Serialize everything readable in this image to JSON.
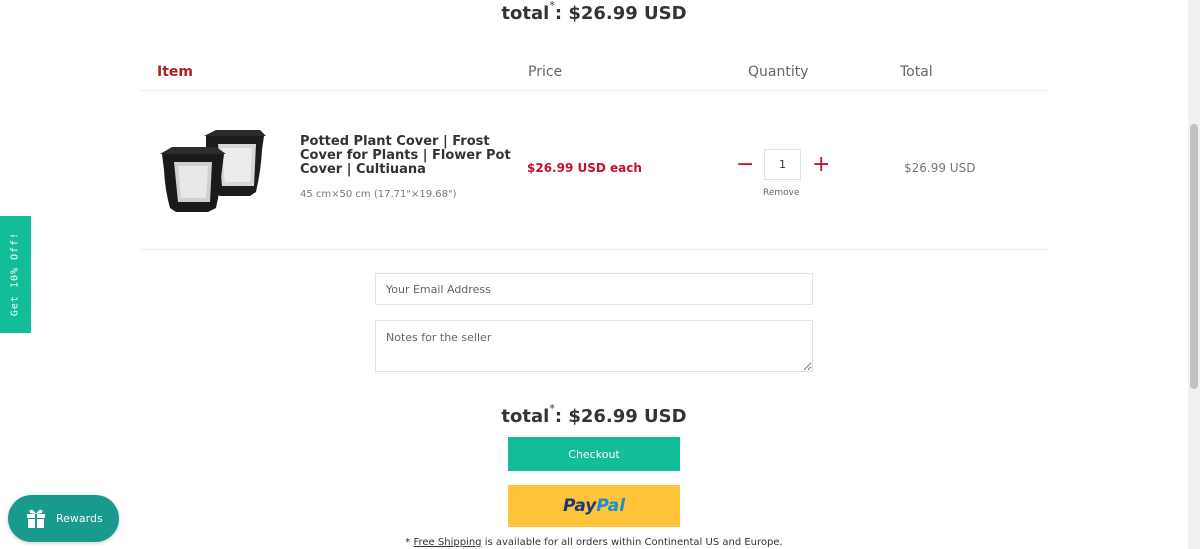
{
  "summary": {
    "total_prefix": "total",
    "total_asterisk": "*",
    "total_colon": ":",
    "total_value": "$26.99 USD"
  },
  "cart": {
    "headers": {
      "item": "Item",
      "price": "Price",
      "quantity": "Quantity",
      "total": "Total"
    },
    "items": [
      {
        "title": "Potted Plant Cover | Frost Cover for Plants | Flower Pot Cover | Cultiuana",
        "variant": "45 cm×50 cm  (17.71\"×19.68\")",
        "price": "$26.99 USD each",
        "quantity": "1",
        "remove_label": "Remove",
        "line_total": "$26.99 USD",
        "minus_symbol": "−",
        "plus_symbol": "+"
      }
    ]
  },
  "form": {
    "email_placeholder": "Your Email Address",
    "notes_placeholder": "Notes for the seller"
  },
  "actions": {
    "checkout_label": "Checkout",
    "paypal_label_a": "Pay",
    "paypal_label_b": "Pal"
  },
  "shipping_note": {
    "prefix": "* ",
    "link": "Free Shipping",
    "suffix": " is available for all orders within Continental US and Europe."
  },
  "side_tab": {
    "label": "Get 10% Off!"
  },
  "rewards": {
    "label": "Rewards"
  },
  "colors": {
    "accent_green": "#12be9a",
    "price_red": "#c8102e",
    "header_item_red": "#b21d1d",
    "paypal_yellow": "#ffc43a",
    "paypal_dark": "#1f3a73",
    "paypal_light": "#1e8bd2",
    "rewards_teal": "#1a9a8d"
  },
  "icons": {
    "gift": "gift-icon",
    "product": "plant-cover-product-image"
  }
}
